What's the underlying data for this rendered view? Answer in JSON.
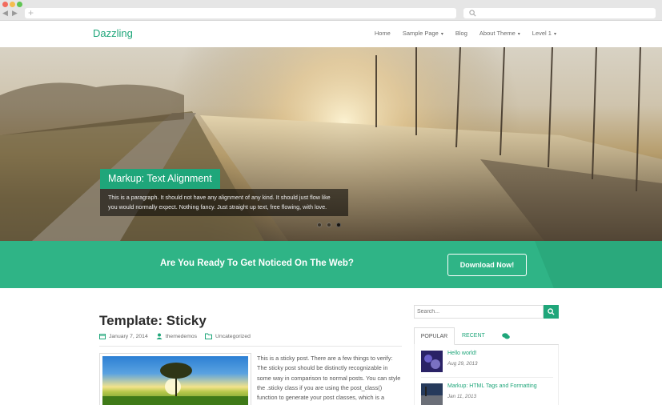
{
  "browser": {
    "tab_plus": "+",
    "back": "◀",
    "forward": "▶"
  },
  "header": {
    "logo": "Dazzling",
    "menu": [
      {
        "label": "Home",
        "has_caret": false
      },
      {
        "label": "Sample Page",
        "has_caret": true
      },
      {
        "label": "Blog",
        "has_caret": false
      },
      {
        "label": "About Theme",
        "has_caret": true
      },
      {
        "label": "Level 1",
        "has_caret": true
      }
    ],
    "caret": "▾"
  },
  "slider": {
    "caption_title": "Markup: Text Alignment",
    "caption_text": "This is a paragraph. It should not have any alignment of any kind. It should just flow like you would normally expect. Nothing fancy. Just straight up text, free flowing, with love.",
    "slide_count": 3,
    "active_slide": 3
  },
  "cta": {
    "text": "Are You Ready To Get Noticed On The Web?",
    "button": "Download Now!"
  },
  "post": {
    "title": "Template: Sticky",
    "date": "January 7, 2014",
    "author": "themedemos",
    "category": "Uncategorized",
    "excerpt": "This is a sticky post. There are a few things to verify: The sticky post should be distinctly recognizable in some way in comparison to normal posts. You can style the .sticky class if you are using the post_class() function to generate your post classes, which is a"
  },
  "sidebar": {
    "search_placeholder": "Search...",
    "tabs": {
      "popular": "POPULAR",
      "recent": "RECENT",
      "comments_icon": "comments-icon"
    },
    "popular_posts": [
      {
        "title": "Hello world!",
        "date": "Aug 29, 2013"
      },
      {
        "title": "Markup: HTML Tags and Formatting",
        "date": "Jan 11, 2013"
      }
    ]
  },
  "colors": {
    "accent": "#1fa67a",
    "cta_band": "#2fb486"
  }
}
